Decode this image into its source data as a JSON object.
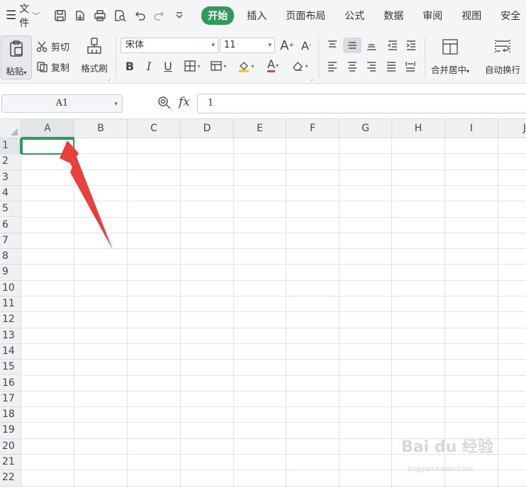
{
  "menu": {
    "file_label": "文件",
    "tabs": [
      {
        "label": "开始",
        "active": true
      },
      {
        "label": "插入"
      },
      {
        "label": "页面布局"
      },
      {
        "label": "公式"
      },
      {
        "label": "数据"
      },
      {
        "label": "审阅"
      },
      {
        "label": "视图"
      },
      {
        "label": "安全"
      }
    ]
  },
  "ribbon": {
    "paste_label": "粘贴",
    "cut_label": "剪切",
    "copy_label": "复制",
    "format_painter_label": "格式刷",
    "font_name": "宋体",
    "font_size": "11",
    "bold": "B",
    "italic": "I",
    "underline": "U",
    "font_grow": "A",
    "font_shrink": "A",
    "font_color_glyph": "A",
    "merge_label": "合并居中",
    "wrap_label": "自动换行"
  },
  "formula_bar": {
    "name_box": "A1",
    "fx_label": "fx",
    "formula_value": "1"
  },
  "sheet": {
    "columns": [
      "A",
      "B",
      "C",
      "D",
      "E",
      "F",
      "G",
      "H",
      "I",
      "J"
    ],
    "rows": [
      "1",
      "2",
      "3",
      "4",
      "5",
      "6",
      "7",
      "8",
      "9",
      "10",
      "11",
      "12",
      "13",
      "14",
      "15",
      "16",
      "17",
      "18",
      "19",
      "20",
      "21",
      "22"
    ],
    "selected_cell": "A1",
    "cell_a1_value": "1"
  },
  "colors": {
    "accent": "#2e9a5b",
    "arrow": "#e8413c"
  },
  "watermark": {
    "brand": "Bai du 经验",
    "url": "jingyan.baidu.com"
  }
}
